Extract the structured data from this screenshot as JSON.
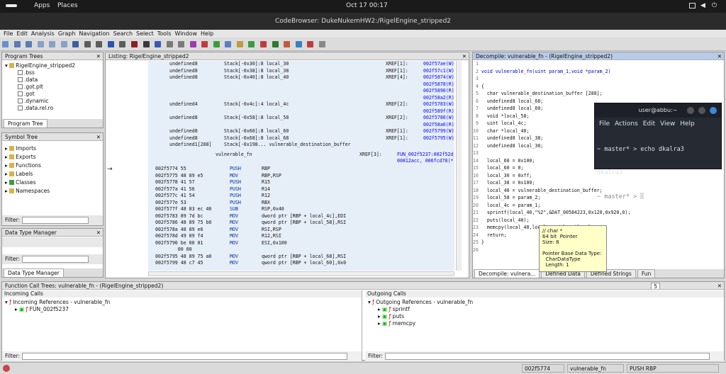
{
  "topbar": {
    "apps": "Apps",
    "places": "Places",
    "clock": "Oct 17  00:17"
  },
  "window": {
    "title": "CodeBrowser: DukeNukemHW2:/RigelEngine_stripped2"
  },
  "menu": [
    "File",
    "Edit",
    "Analysis",
    "Graph",
    "Navigation",
    "Search",
    "Select",
    "Tools",
    "Window",
    "Help"
  ],
  "program_trees": {
    "title": "Program Trees",
    "root": "RigelEngine_stripped2",
    "items": [
      ".bss",
      ".data",
      ".got.plt",
      ".got",
      ".dynamic",
      ".data.rel.ro"
    ],
    "tab": "Program Tree"
  },
  "symbol_tree": {
    "title": "Symbol Tree",
    "items": [
      "Imports",
      "Exports",
      "Functions",
      "Labels",
      "Classes",
      "Namespaces"
    ],
    "filter": "Filter:"
  },
  "data_type_manager": {
    "title": "Data Type Manager",
    "filter": "Filter:",
    "tab": "Data Type Manager"
  },
  "listing": {
    "title": "Listing:  RigelEngine_stripped2",
    "vars": [
      [
        "undefined8",
        "Stack[-0x30]:8 local_30",
        "XREF[1]:",
        "002f57ae(W)"
      ],
      [
        "undefined8",
        "Stack[-0x38]:8 local_38",
        "XREF[1]:",
        "002f57c1(W)"
      ],
      [
        "undefined8",
        "Stack[-0x40]:8 local_40",
        "XREF[4]:",
        "002f5874(W)"
      ],
      [
        "",
        "",
        "",
        "002f5878(R)"
      ],
      [
        "",
        "",
        "",
        "002f5890(R)"
      ],
      [
        "",
        "",
        "",
        "002f58a2(R)"
      ],
      [
        "undefined4",
        "Stack[-0x4c]:4 local_4c",
        "XREF[2]:",
        "002f5783(W)"
      ],
      [
        "",
        "",
        "",
        "002f589f(R)"
      ],
      [
        "undefined8",
        "Stack[-0x58]:8 local_58",
        "XREF[2]:",
        "002f5786(W)"
      ],
      [
        "",
        "",
        "",
        "002f58a6(R)"
      ],
      [
        "undefined8",
        "Stack[-0x60]:8 local_60",
        "XREF[1]:",
        "002f5799(W)"
      ],
      [
        "undefined8",
        "Stack[-0x68]:8 local_68",
        "XREF[1]:",
        "002f5795(W)"
      ],
      [
        "undefined1[288]",
        "Stack[-0x198... vulnerable_destination_buffer",
        "",
        ""
      ]
    ],
    "fn_label": "vulnerable_fn",
    "fn_xref": "XREF[3]:",
    "fn_xref_val1": "FUN_002f5237:002f52d",
    "fn_xref_val2": "00812acc, 006fcd78(*",
    "instr": [
      [
        "002f5774 55",
        "PUSH",
        "RBP"
      ],
      [
        "002f5775 48 89 e5",
        "MOV",
        "RBP,RSP"
      ],
      [
        "002f5778 41 57",
        "PUSH",
        "R15"
      ],
      [
        "002f577a 41 56",
        "PUSH",
        "R14"
      ],
      [
        "002f577c 41 54",
        "PUSH",
        "R12"
      ],
      [
        "002f577e 53",
        "PUSH",
        "RBX"
      ],
      [
        "002f577f 48 83 ec 40",
        "SUB",
        "RSP,0x40"
      ],
      [
        "002f5783 89 7d bc",
        "MOV",
        "dword ptr [RBP + local_4c],EDI"
      ],
      [
        "002f5786 48 89 75 b0",
        "MOV",
        "qword ptr [RBP + local_58],RSI"
      ],
      [
        "002f578a 48 89 e6",
        "MOV",
        "RSI,RSP"
      ],
      [
        "002f578d 49 89 f4",
        "MOV",
        "R12,RSI"
      ],
      [
        "002f5790 be 00 01",
        "MOV",
        "ESI,0x100"
      ],
      [
        "        00 00",
        "",
        ""
      ],
      [
        "002f5795 48 89 75 a0",
        "MOV",
        "qword ptr [RBP + local_68],RSI"
      ],
      [
        "002f5799 48 c7 45",
        "MOV",
        "qword ptr [RBP + local_60],0x0"
      ]
    ]
  },
  "decompile": {
    "title": "Decompile: vulnerable_fn -  (RigelEngine_stripped2)",
    "lines": [
      "",
      "void vulnerable_fn(uint param_1,void *param_2)",
      "",
      "{",
      "  char vulnerable_destination_buffer [288];",
      "  undefined8 local_68;",
      "  undefined8 local_60;",
      "  void *local_58;",
      "  uint local_4c;",
      "  char *local_40;",
      "  undefined8 local_38;",
      "  undefined8 local_30;",
      "",
      "  local_68 = 0x100;",
      "  local_60 = 0;",
      "  local_30 = 0xff;",
      "  local_38 = 0x100;",
      "  local_40 = vulnerable_destination_buffer;",
      "  local_58 = param_2;",
      "  local_4c = param_1;",
      "  sprintf(local_40,\"%2\",&DAT_00584223,0x120,0x920,0);",
      "  puts(local_40);",
      "  memcpy(local_40,local_58,(ulong)local_4c);",
      "  return;",
      "}",
      ""
    ],
    "tabs": [
      "Decompile: vulnera...",
      "Defined Data",
      "Defined Strings",
      "Fun"
    ]
  },
  "tooltip": {
    "lines": [
      "// char *",
      "64 bit  Pointer",
      "Size: 8",
      "",
      "Pointer Base Data Type:",
      "  CharDataType",
      "  Length: 1"
    ]
  },
  "terminal": {
    "title": "user@abbu:~",
    "menu": [
      "File",
      "Actions",
      "Edit",
      "View",
      "Help"
    ],
    "lines": [
      "~ master* > echo dkalra3",
      "dkalra3",
      "~ master* > "
    ]
  },
  "call_trees": {
    "title": "Function Call Trees: vulnerable_fn - (RigelEngine_stripped2)",
    "count": "5",
    "incoming": {
      "title": "Incoming Calls",
      "root": "Incoming References - vulnerable_fn",
      "items": [
        "FUN_002f5237"
      ]
    },
    "outgoing": {
      "title": "Outgoing Calls",
      "root": "Outgoing References - vulnerable_fn",
      "items": [
        "sprintf",
        "puts",
        "memcpy"
      ]
    },
    "filter": "Filter:"
  },
  "status": {
    "addr": "002f5774",
    "fn": "vulnerable_fn",
    "instr": "PUSH RBP"
  },
  "colors": {
    "accent": "#b9cbe6",
    "function": "#0000ff",
    "xref": "#00aa00"
  }
}
